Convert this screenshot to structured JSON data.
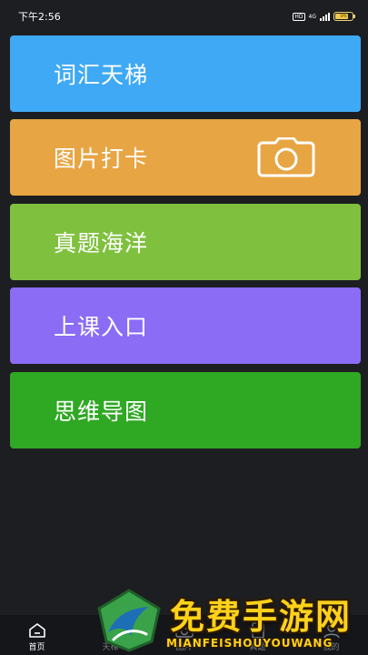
{
  "status_bar": {
    "time": "下午2:56",
    "hd_label": "HD",
    "network_label": "4G",
    "battery_label": "96"
  },
  "menu": {
    "items": [
      {
        "label": "词汇天梯",
        "color": "#3fa9f5"
      },
      {
        "label": "图片打卡",
        "color": "#e8a544",
        "icon": "camera-icon"
      },
      {
        "label": "真题海洋",
        "color": "#7fc13e"
      },
      {
        "label": "上课入口",
        "color": "#8a6cf5"
      },
      {
        "label": "思维导图",
        "color": "#2fa823"
      }
    ]
  },
  "bottom_nav": {
    "items": [
      {
        "label": "首页",
        "icon": "home-icon",
        "active": true
      },
      {
        "label": "天梯",
        "icon": "ladder-icon",
        "active": false
      },
      {
        "label": "图片",
        "icon": "camera-icon",
        "active": false
      },
      {
        "label": "真题",
        "icon": "document-icon",
        "active": false
      },
      {
        "label": "我的",
        "icon": "user-icon",
        "active": false
      }
    ]
  },
  "watermark": {
    "title": "免费手游网",
    "subtitle": "MIANFEISHOUYOUWANG"
  }
}
